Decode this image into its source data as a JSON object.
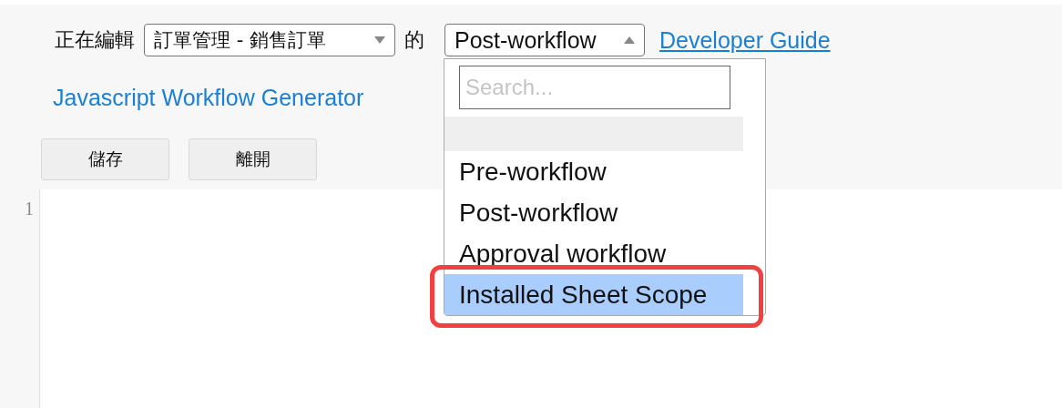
{
  "toolbar": {
    "editing_label": "正在編輯",
    "form_select": {
      "value": "訂單管理 - 銷售訂單",
      "expanded": false
    },
    "of_label": "的",
    "type_select": {
      "value": "Post-workflow",
      "expanded": true
    },
    "guide_link": "Developer Guide"
  },
  "generator_link": "Javascript Workflow Generator",
  "buttons": [
    "儲存",
    "離開"
  ],
  "editor": {
    "line_numbers": [
      "1"
    ]
  },
  "dropdown": {
    "search": {
      "placeholder": "Search..."
    },
    "options": [
      {
        "kind": "blank",
        "selected": false,
        "annotated": false
      },
      {
        "kind": "text",
        "label": "Pre-workflow",
        "selected": false,
        "annotated": false
      },
      {
        "kind": "text",
        "label": "Post-workflow",
        "selected": false,
        "annotated": false
      },
      {
        "kind": "text",
        "label": "Approval workflow",
        "selected": false,
        "annotated": false
      },
      {
        "kind": "text",
        "label": "Installed Sheet Scope",
        "selected": true,
        "annotated": true
      }
    ]
  }
}
